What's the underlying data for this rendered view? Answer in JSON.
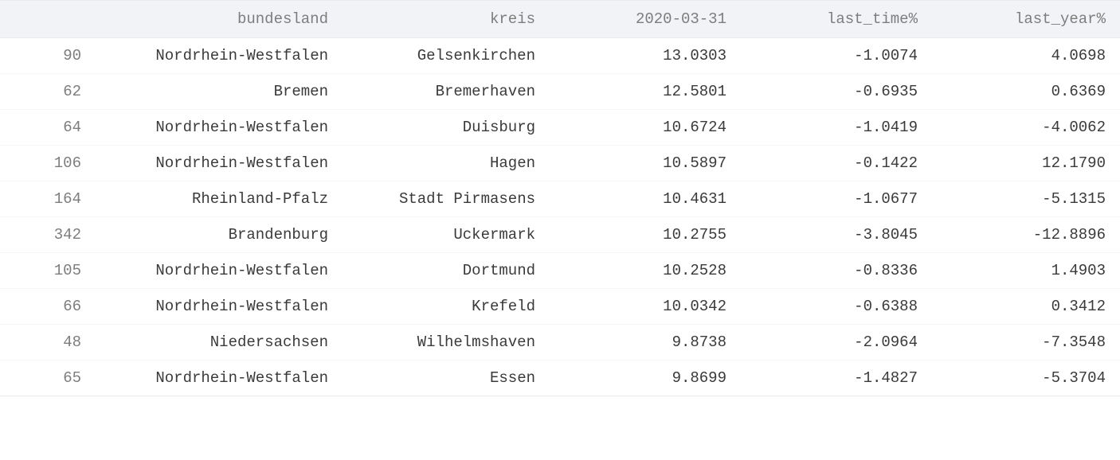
{
  "table": {
    "headers": {
      "index": "",
      "bundesland": "bundesland",
      "kreis": "kreis",
      "date": "2020-03-31",
      "last_time": "last_time%",
      "last_year": "last_year%"
    },
    "rows": [
      {
        "index": "90",
        "bundesland": "Nordrhein-Westfalen",
        "kreis": "Gelsenkirchen",
        "date": "13.0303",
        "last_time": "-1.0074",
        "last_year": "4.0698"
      },
      {
        "index": "62",
        "bundesland": "Bremen",
        "kreis": "Bremerhaven",
        "date": "12.5801",
        "last_time": "-0.6935",
        "last_year": "0.6369"
      },
      {
        "index": "64",
        "bundesland": "Nordrhein-Westfalen",
        "kreis": "Duisburg",
        "date": "10.6724",
        "last_time": "-1.0419",
        "last_year": "-4.0062"
      },
      {
        "index": "106",
        "bundesland": "Nordrhein-Westfalen",
        "kreis": "Hagen",
        "date": "10.5897",
        "last_time": "-0.1422",
        "last_year": "12.1790"
      },
      {
        "index": "164",
        "bundesland": "Rheinland-Pfalz",
        "kreis": "Stadt Pirmasens",
        "date": "10.4631",
        "last_time": "-1.0677",
        "last_year": "-5.1315"
      },
      {
        "index": "342",
        "bundesland": "Brandenburg",
        "kreis": "Uckermark",
        "date": "10.2755",
        "last_time": "-3.8045",
        "last_year": "-12.8896"
      },
      {
        "index": "105",
        "bundesland": "Nordrhein-Westfalen",
        "kreis": "Dortmund",
        "date": "10.2528",
        "last_time": "-0.8336",
        "last_year": "1.4903"
      },
      {
        "index": "66",
        "bundesland": "Nordrhein-Westfalen",
        "kreis": "Krefeld",
        "date": "10.0342",
        "last_time": "-0.6388",
        "last_year": "0.3412"
      },
      {
        "index": "48",
        "bundesland": "Niedersachsen",
        "kreis": "Wilhelmshaven",
        "date": "9.8738",
        "last_time": "-2.0964",
        "last_year": "-7.3548"
      },
      {
        "index": "65",
        "bundesland": "Nordrhein-Westfalen",
        "kreis": "Essen",
        "date": "9.8699",
        "last_time": "-1.4827",
        "last_year": "-5.3704"
      }
    ]
  }
}
